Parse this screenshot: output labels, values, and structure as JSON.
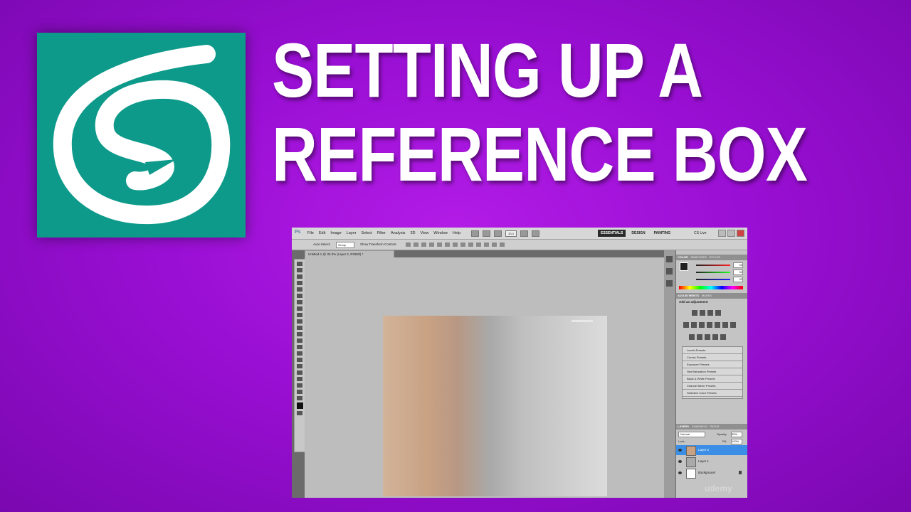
{
  "thumbnail": {
    "title_line1": "SETTING UP A",
    "title_line2": "REFERENCE BOX",
    "logo_icon": "3ds-max-logo-icon",
    "bg_color": "#9a0fd4",
    "logo_color": "#0e9a8a"
  },
  "photoshop": {
    "app_logo": "Ps",
    "menus": [
      "File",
      "Edit",
      "Image",
      "Layer",
      "Select",
      "Filter",
      "Analysis",
      "3D",
      "View",
      "Window",
      "Help"
    ],
    "workspaces": [
      "ESSENTIALS",
      "DESIGN",
      "PAINTING"
    ],
    "active_workspace": "ESSENTIALS",
    "cs_live": "CS Live",
    "zoom_value": "33.3",
    "options": {
      "auto_select": "Auto-Select:",
      "group": "Group",
      "show_transform": "Show Transform Controls"
    },
    "document_tab": "Untitled-1 @ 33.3% (Layer 2, RGB/8) *",
    "color_panel": {
      "tabs": [
        "COLOR",
        "SWATCHES",
        "STYLES"
      ],
      "r": "32",
      "g": "32",
      "b": "32"
    },
    "adjustments_panel": {
      "tabs": [
        "ADJUSTMENTS",
        "MASKS"
      ],
      "heading": "Add an adjustment",
      "presets": [
        "Levels Presets",
        "Curves Presets",
        "Exposure Presets",
        "Hue/Saturation Presets",
        "Black & White Presets",
        "Channel Mixer Presets",
        "Selective Color Presets"
      ]
    },
    "layers_panel": {
      "tabs": [
        "LAYERS",
        "CHANNELS",
        "PATHS"
      ],
      "blend_mode": "Normal",
      "opacity_label": "Opacity:",
      "opacity": "55%",
      "lock_label": "Lock:",
      "fill_label": "Fill:",
      "fill": "100%",
      "layers": [
        {
          "name": "Layer 2",
          "selected": true
        },
        {
          "name": "Layer 1",
          "selected": false
        },
        {
          "name": "Background",
          "selected": false
        }
      ]
    },
    "watermark": "udemy"
  }
}
